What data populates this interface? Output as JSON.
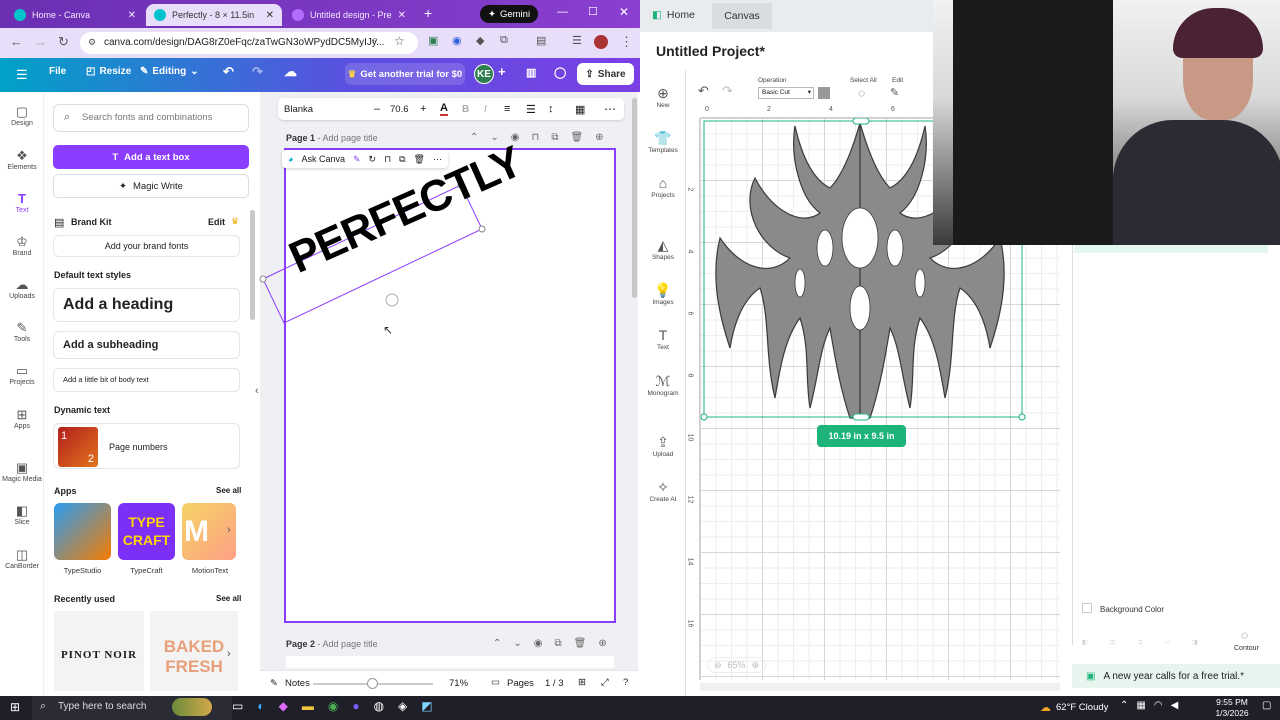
{
  "browser": {
    "tabs": [
      {
        "label": "Home - Canva",
        "active": false
      },
      {
        "label": "Perfectly - 8 × 11.5in",
        "active": true
      },
      {
        "label": "Untitled design - Presen",
        "active": false
      }
    ],
    "gemini_label": "Gemini",
    "url": "canva.com/design/DAG8rZ0eFqc/zaTwGN3oWPydDC5MyIJy..."
  },
  "canva": {
    "header": {
      "file": "File",
      "resize": "Resize",
      "editing": "Editing",
      "trial": "Get another trial for $0",
      "avatar": "KE",
      "share": "Share"
    },
    "rail": [
      {
        "label": "Design",
        "icon": "design-icon"
      },
      {
        "label": "Elements",
        "icon": "elements-icon"
      },
      {
        "label": "Text",
        "icon": "text-icon"
      },
      {
        "label": "Brand",
        "icon": "brand-icon"
      },
      {
        "label": "Uploads",
        "icon": "uploads-icon"
      },
      {
        "label": "Tools",
        "icon": "tools-icon"
      },
      {
        "label": "Projects",
        "icon": "projects-icon"
      },
      {
        "label": "Apps",
        "icon": "apps-icon"
      },
      {
        "label": "Magic Media",
        "icon": "magic-media-icon"
      },
      {
        "label": "Slice",
        "icon": "slice-icon"
      },
      {
        "label": "CanBorder",
        "icon": "canborder-icon"
      }
    ],
    "panel": {
      "search_placeholder": "Search fonts and combinations",
      "add_text_box": "Add a text box",
      "magic_write": "Magic Write",
      "brand_kit": "Brand Kit",
      "brand_edit": "Edit",
      "add_brand_fonts": "Add your brand fonts",
      "default_styles": "Default text styles",
      "heading": "Add a heading",
      "subheading": "Add a subheading",
      "body": "Add a little bit of body text",
      "dynamic_text": "Dynamic text",
      "page_numbers": "Page numbers",
      "apps": "Apps",
      "see_all": "See all",
      "app_items": [
        "TypeStudio",
        "TypeCraft",
        "MotionText"
      ],
      "recently_used": "Recently used",
      "recent_items": [
        "PINOT NOIR",
        "BAKED FRESH"
      ]
    },
    "toolbar": {
      "font": "Blanka",
      "size": "70.6"
    },
    "page1_label": "Page 1",
    "page2_label": "Page 2",
    "add_page_title": "- Add page title",
    "ask_canva": "Ask Canva",
    "text_content": "PERFECTLY",
    "bottom": {
      "notes": "Notes",
      "zoom": "71%",
      "pages": "Pages",
      "page_count": "1 / 3"
    }
  },
  "cricut": {
    "tabs": [
      "Home",
      "Canvas"
    ],
    "title": "Untitled Project*",
    "operation_label": "Operation",
    "operation_value": "Basic Cut",
    "select_all": "Select All",
    "edit": "Edit",
    "tools": [
      {
        "label": "New",
        "icon": "plus-icon"
      },
      {
        "label": "Templates",
        "icon": "templates-icon"
      },
      {
        "label": "Projects",
        "icon": "projects-icon"
      },
      {
        "label": "Shapes",
        "icon": "shapes-icon"
      },
      {
        "label": "Images",
        "icon": "images-icon"
      },
      {
        "label": "Text",
        "icon": "text-icon"
      },
      {
        "label": "Monogram",
        "icon": "monogram-icon"
      },
      {
        "label": "Upload",
        "icon": "upload-icon"
      },
      {
        "label": "Create AI",
        "icon": "create-ai-icon"
      }
    ],
    "ruler_top": [
      "0",
      "2",
      "4",
      "6"
    ],
    "ruler_left": [
      "2",
      "4",
      "6",
      "8",
      "10",
      "12",
      "14",
      "16"
    ],
    "size_badge": "10.19  in x 9.5  in",
    "background_color": "Background Color",
    "contour": "Contour",
    "zoom": "65%",
    "promo": "A new year calls for a free trial.*"
  },
  "taskbar": {
    "search_placeholder": "Type here to search",
    "weather": "62°F  Cloudy",
    "time": "9:55 PM",
    "date": "1/3/2026"
  }
}
